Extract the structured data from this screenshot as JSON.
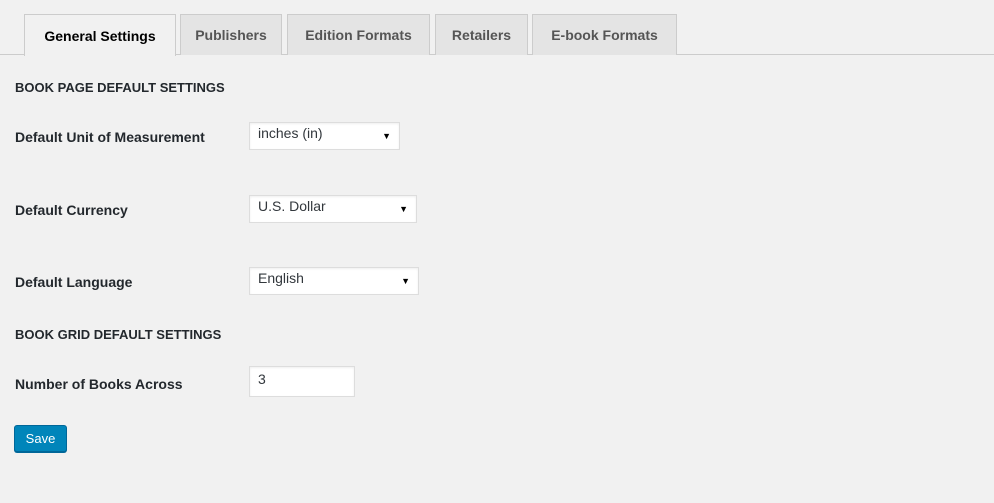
{
  "tabs": [
    {
      "label": "General Settings",
      "active": true
    },
    {
      "label": "Publishers",
      "active": false
    },
    {
      "label": "Edition Formats",
      "active": false
    },
    {
      "label": "Retailers",
      "active": false
    },
    {
      "label": "E-book Formats",
      "active": false
    }
  ],
  "book_page_section": {
    "heading": "BOOK PAGE DEFAULT SETTINGS",
    "unit_of_measurement": {
      "label": "Default Unit of Measurement",
      "value": "inches (in)"
    },
    "currency": {
      "label": "Default Currency",
      "value": "U.S. Dollar"
    },
    "language": {
      "label": "Default Language",
      "value": "English"
    }
  },
  "book_grid_section": {
    "heading": "BOOK GRID DEFAULT SETTINGS",
    "books_across": {
      "label": "Number of Books Across",
      "value": "3"
    }
  },
  "actions": {
    "save_label": "Save"
  },
  "icons": {
    "dropdown_arrow": "▼"
  },
  "colors": {
    "primary_button": "#0085ba",
    "page_background": "#f1f1f1"
  }
}
